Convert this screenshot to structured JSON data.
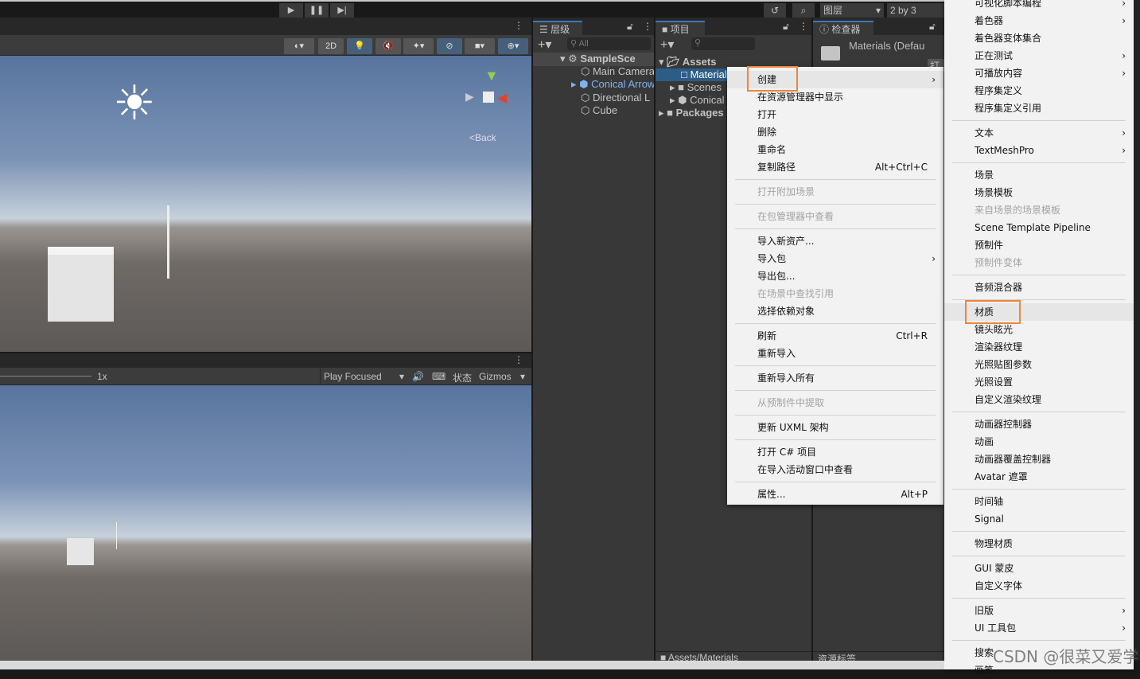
{
  "toolbar": {
    "play": "▶",
    "pause": "❚❚",
    "step": "▶|",
    "history_icon": "history-icon",
    "search_icon": "search-icon",
    "layers": "图层",
    "layout": "2 by 3"
  },
  "scene": {
    "btn_2d": "2D"
  },
  "game": {
    "scale": "1x",
    "play_mode": "Play Focused",
    "stats": "状态",
    "gizmos": "Gizmos"
  },
  "hierarchy": {
    "title": "层级",
    "search_placeholder": "All",
    "scene": "SampleSce",
    "items": [
      "Main Camera",
      "Conical Arrow",
      "Directional L",
      "Cube"
    ]
  },
  "project": {
    "title": "项目",
    "root": "Assets",
    "items": [
      "Materials",
      "Scenes",
      "Conical"
    ],
    "packages": "Packages",
    "footer": "Assets/Materials"
  },
  "inspector": {
    "title": "检查器",
    "object": "Materials (Defau",
    "open": "打开",
    "footer": "资源标签"
  },
  "context_menu": {
    "groups": [
      [
        {
          "label": "创建",
          "arrow": true,
          "hl": true
        },
        {
          "label": "在资源管理器中显示"
        },
        {
          "label": "打开"
        },
        {
          "label": "删除"
        },
        {
          "label": "重命名"
        },
        {
          "label": "复制路径",
          "shortcut": "Alt+Ctrl+C"
        }
      ],
      [
        {
          "label": "打开附加场景",
          "disabled": true
        }
      ],
      [
        {
          "label": "在包管理器中查看",
          "disabled": true
        }
      ],
      [
        {
          "label": "导入新资产..."
        },
        {
          "label": "导入包",
          "arrow": true
        },
        {
          "label": "导出包..."
        },
        {
          "label": "在场景中查找引用",
          "disabled": true
        },
        {
          "label": "选择依赖对象"
        }
      ],
      [
        {
          "label": "刷新",
          "shortcut": "Ctrl+R"
        },
        {
          "label": "重新导入"
        }
      ],
      [
        {
          "label": "重新导入所有"
        }
      ],
      [
        {
          "label": "从预制件中提取",
          "disabled": true
        }
      ],
      [
        {
          "label": "更新 UXML 架构"
        }
      ],
      [
        {
          "label": "打开 C# 项目"
        },
        {
          "label": "在导入活动窗口中查看"
        }
      ],
      [
        {
          "label": "属性...",
          "shortcut": "Alt+P"
        }
      ]
    ]
  },
  "submenu": {
    "groups": [
      [
        {
          "label": "可视化脚本编程",
          "arrow": true
        },
        {
          "label": "着色器",
          "arrow": true
        },
        {
          "label": "着色器变体集合"
        },
        {
          "label": "正在测试",
          "arrow": true
        },
        {
          "label": "可播放内容",
          "arrow": true
        },
        {
          "label": "程序集定义"
        },
        {
          "label": "程序集定义引用"
        }
      ],
      [
        {
          "label": "文本",
          "arrow": true
        },
        {
          "label": "TextMeshPro",
          "arrow": true
        }
      ],
      [
        {
          "label": "场景"
        },
        {
          "label": "场景模板"
        },
        {
          "label": "来自场景的场景模板",
          "disabled": true
        },
        {
          "label": "Scene Template Pipeline"
        },
        {
          "label": "预制件"
        },
        {
          "label": "预制件变体",
          "disabled": true
        }
      ],
      [
        {
          "label": "音频混合器"
        }
      ],
      [
        {
          "label": "材质",
          "hl": true
        },
        {
          "label": "镜头眩光"
        },
        {
          "label": "渲染器纹理"
        },
        {
          "label": "光照贴图参数"
        },
        {
          "label": "光照设置"
        },
        {
          "label": "自定义渲染纹理"
        }
      ],
      [
        {
          "label": "动画器控制器"
        },
        {
          "label": "动画"
        },
        {
          "label": "动画器覆盖控制器"
        },
        {
          "label": "Avatar 遮罩"
        }
      ],
      [
        {
          "label": "时间轴"
        },
        {
          "label": "Signal"
        }
      ],
      [
        {
          "label": "物理材质"
        }
      ],
      [
        {
          "label": "GUI 蒙皮"
        },
        {
          "label": "自定义字体"
        }
      ],
      [
        {
          "label": "旧版",
          "arrow": true
        },
        {
          "label": "UI 工具包",
          "arrow": true
        }
      ],
      [
        {
          "label": "搜索"
        },
        {
          "label": "画笔"
        }
      ]
    ]
  },
  "watermark": "CSDN @很菜又爱学"
}
